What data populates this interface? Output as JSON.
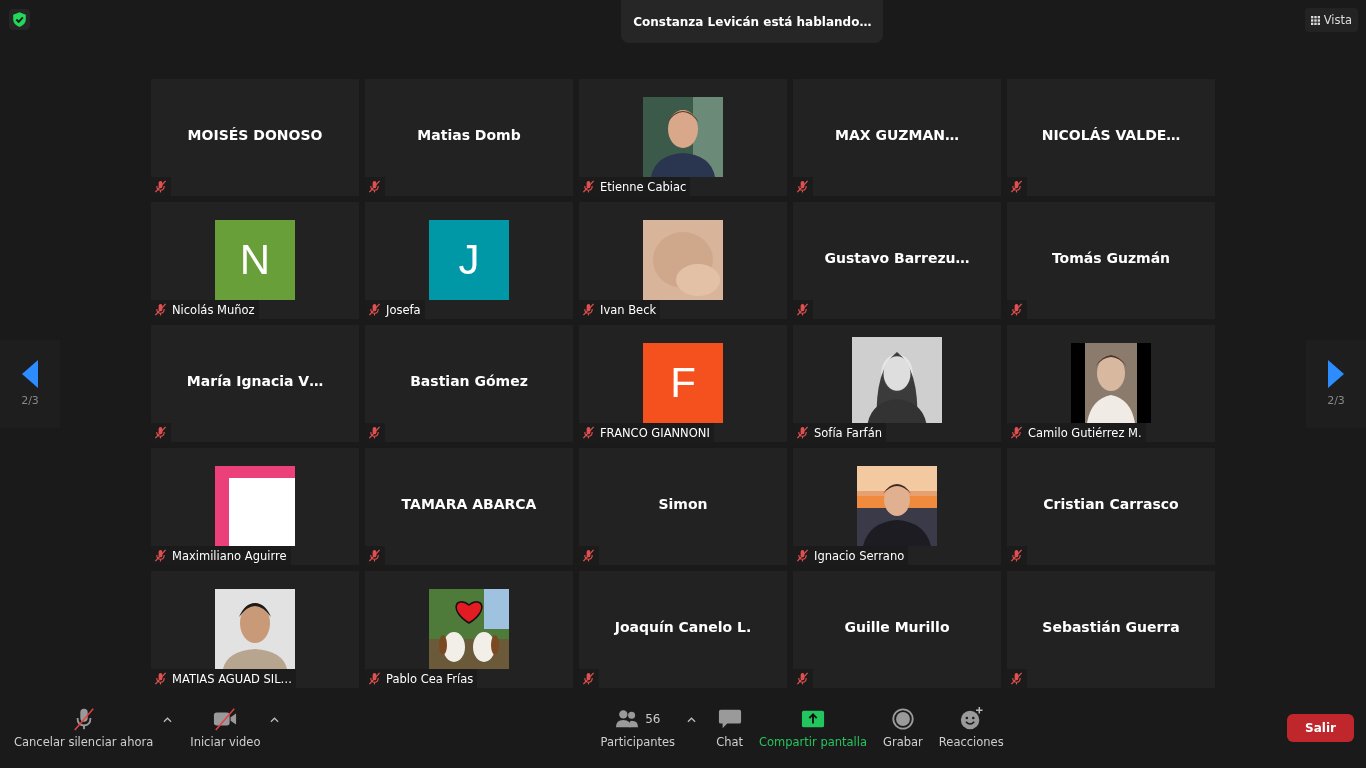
{
  "top": {
    "status": "Constanza Levicán está hablando…",
    "view_button": "Vista"
  },
  "pager": {
    "previous": "2/3",
    "next": "2/3"
  },
  "tiles": [
    {
      "kind": "name",
      "name": "MOISÉS DONOSO",
      "muted": true
    },
    {
      "kind": "name",
      "name": "Matias Domb",
      "muted": true
    },
    {
      "kind": "picture",
      "name": "Etienne Cabiac",
      "muted": true
    },
    {
      "kind": "name",
      "name": "MAX GUZMAN…",
      "muted": true
    },
    {
      "kind": "name",
      "name": "NICOLÁS VALDE…",
      "muted": true
    },
    {
      "kind": "avatar",
      "initial": "N",
      "color": "#689f38",
      "name": "Nicolás Muñoz",
      "muted": true
    },
    {
      "kind": "avatar",
      "initial": "J",
      "color": "#0097a7",
      "name": "Josefa",
      "muted": true
    },
    {
      "kind": "picture",
      "name": "Ivan Beck",
      "muted": true
    },
    {
      "kind": "name",
      "name": "Gustavo Barrezu…",
      "muted": true
    },
    {
      "kind": "name",
      "name": "Tomás Guzmán",
      "muted": true
    },
    {
      "kind": "name",
      "name": "María Ignacia V…",
      "muted": true
    },
    {
      "kind": "name",
      "name": "Bastian Gómez",
      "muted": true
    },
    {
      "kind": "avatar",
      "initial": "F",
      "color": "#f4511e",
      "name": "FRANCO GIANNONI",
      "muted": true
    },
    {
      "kind": "picture",
      "name": "Sofía Farfán",
      "muted": true
    },
    {
      "kind": "picture",
      "name": "Camilo Gutiérrez M.",
      "muted": true
    },
    {
      "kind": "picture",
      "name": "Maximiliano Aguirre",
      "muted": true
    },
    {
      "kind": "name",
      "name": "TAMARA ABARCA",
      "muted": true
    },
    {
      "kind": "name",
      "name": "Simon",
      "muted": true
    },
    {
      "kind": "picture",
      "name": "Ignacio Serrano",
      "muted": true
    },
    {
      "kind": "name",
      "name": "Cristian Carrasco",
      "muted": true
    },
    {
      "kind": "picture",
      "name": "MATIAS AGUAD SIL…",
      "muted": true
    },
    {
      "kind": "picture",
      "name": "Pablo Cea Frías",
      "muted": true
    },
    {
      "kind": "name",
      "name": "Joaquín Canelo L.",
      "muted": true
    },
    {
      "kind": "name",
      "name": "Guille Murillo",
      "muted": true
    },
    {
      "kind": "name",
      "name": "Sebastián Guerra",
      "muted": true
    }
  ],
  "toolbar_left": [
    {
      "kind": "mic",
      "label": "Cancelar silenciar ahora",
      "caret": true
    },
    {
      "kind": "video",
      "label": "Iniciar video",
      "caret": true
    }
  ],
  "toolbar_center": [
    {
      "kind": "participants",
      "label": "Participantes",
      "count": "56",
      "caret": true
    },
    {
      "kind": "chat",
      "label": "Chat",
      "caret": false
    },
    {
      "kind": "share",
      "label": "Compartir pantalla",
      "caret": false
    },
    {
      "kind": "record",
      "label": "Grabar",
      "caret": false
    },
    {
      "kind": "reactions",
      "label": "Reacciones",
      "caret": false
    }
  ],
  "leave_button": "Salir"
}
